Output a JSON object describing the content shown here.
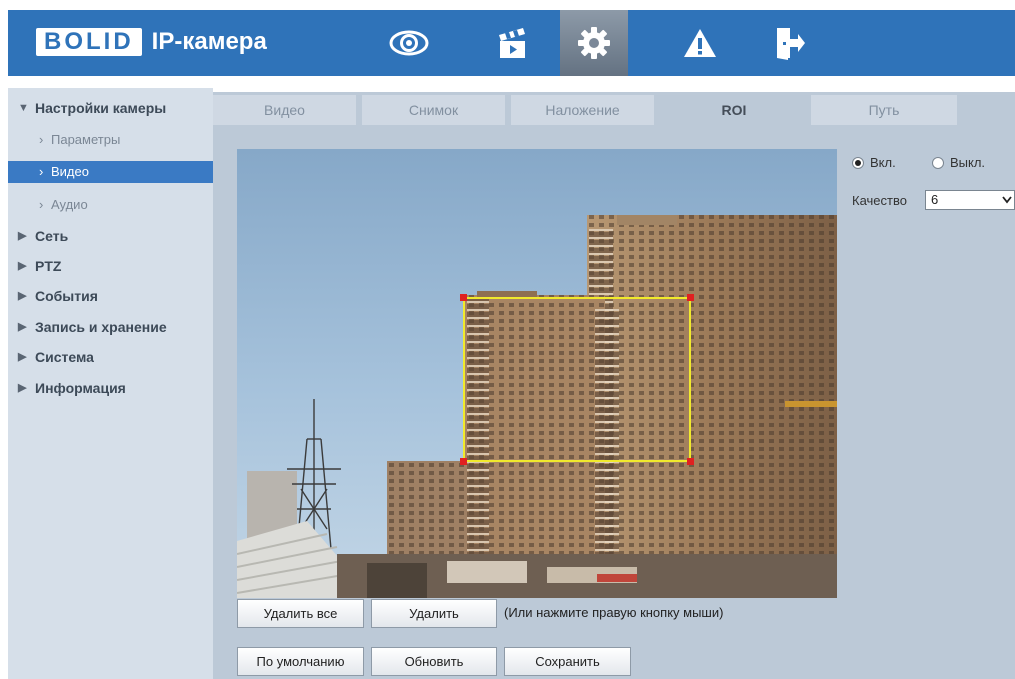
{
  "header": {
    "logo_text": "BOLID",
    "title": "IP-камера",
    "nav": [
      {
        "icon": "eye-icon",
        "active": false
      },
      {
        "icon": "clapperboard-icon",
        "active": false
      },
      {
        "icon": "gear-icon",
        "active": true
      },
      {
        "icon": "warning-icon",
        "active": false
      },
      {
        "icon": "logout-icon",
        "active": false
      }
    ]
  },
  "sidebar": {
    "camera_settings": "Настройки камеры",
    "sub": {
      "params": "Параметры",
      "video": "Видео",
      "audio": "Аудио"
    },
    "network": "Сеть",
    "ptz": "PTZ",
    "events": "События",
    "recording": "Запись и хранение",
    "system": "Система",
    "info": "Информация"
  },
  "tabs": {
    "video": "Видео",
    "snapshot": "Снимок",
    "overlay": "Наложение",
    "roi": "ROI",
    "path": "Путь"
  },
  "roi": {
    "on_label": "Вкл.",
    "off_label": "Выкл.",
    "enabled": true,
    "quality_label": "Качество",
    "quality_value": "6"
  },
  "buttons": {
    "delete_all": "Удалить все",
    "delete": "Удалить",
    "hint": "(Или нажмите правую кнопку мыши)",
    "default": "По умолчанию",
    "refresh": "Обновить",
    "save": "Сохранить"
  },
  "colors": {
    "header": "#2f73b9",
    "sidebar_bg": "#d6dfe9",
    "selected": "#3a7ac4",
    "roi_frame": "#f1ea2c",
    "roi_handle": "#e02020"
  }
}
